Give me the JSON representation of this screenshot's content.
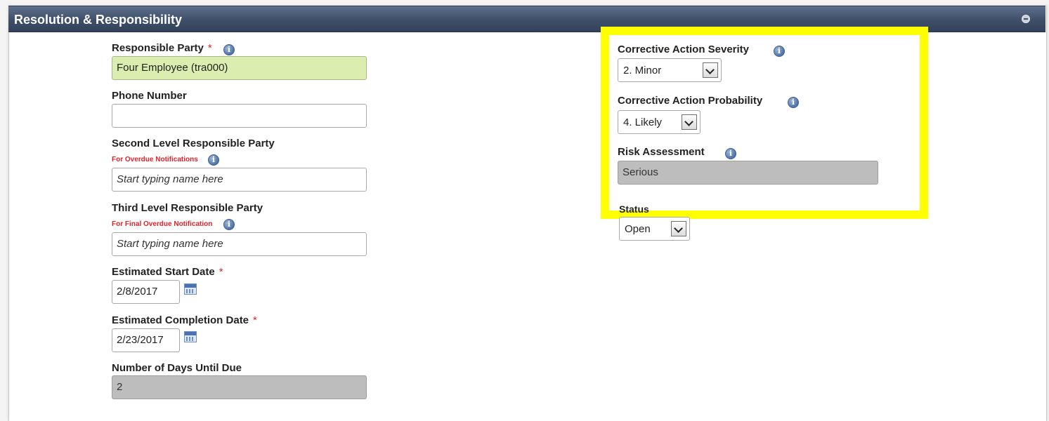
{
  "section": {
    "title": "Resolution & Responsibility",
    "collapse_icon": "minus-circle-icon"
  },
  "required_marker": "*",
  "left": {
    "responsible_party": {
      "label": "Responsible Party",
      "value": "Four Employee (tra000)"
    },
    "phone_number": {
      "label": "Phone Number",
      "value": ""
    },
    "second_level": {
      "label": "Second Level Responsible Party",
      "note": "For Overdue Notifications",
      "placeholder": "Start typing name here"
    },
    "third_level": {
      "label": "Third Level Responsible Party",
      "note": "For Final Overdue Notification",
      "placeholder": "Start typing name here"
    },
    "estimated_start": {
      "label": "Estimated Start Date",
      "value": "2/8/2017"
    },
    "estimated_completion": {
      "label": "Estimated Completion Date",
      "value": "2/23/2017"
    },
    "days_until_due": {
      "label": "Number of Days Until Due",
      "value": "2"
    }
  },
  "right": {
    "severity": {
      "label": "Corrective Action Severity",
      "value": "2. Minor"
    },
    "probability": {
      "label": "Corrective Action Probability",
      "value": "4. Likely"
    },
    "risk": {
      "label": "Risk Assessment",
      "value": "Serious"
    },
    "status": {
      "label": "Status",
      "value": "Open"
    }
  },
  "colors": {
    "header": "#3f4f69",
    "highlight": "#ffff00",
    "required": "#e0222a",
    "green_field": "#dbeeb0",
    "readonly_field": "#bdbdbd"
  }
}
